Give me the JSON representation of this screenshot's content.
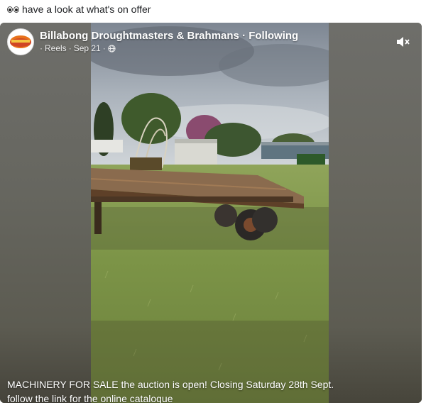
{
  "post": {
    "text": "have a look at what's on offer"
  },
  "reel": {
    "page_name": "Billabong Droughtmasters & Brahmans",
    "follow_status": "Following",
    "section": "Reels",
    "date": "Sep 21",
    "audience_icon": "globe-icon",
    "mute_icon": "speaker-muted-icon",
    "avatar_text": "BILLABONG",
    "caption_line1": "MACHINERY FOR SALE the auction is open! Closing Saturday 28th Sept.",
    "caption_line2": "follow the link for the online catalogue"
  },
  "colors": {
    "text_dark": "#1c1e21",
    "overlay_text": "#ffffff",
    "logo_orange": "#e8731c",
    "logo_red": "#c0282c"
  }
}
